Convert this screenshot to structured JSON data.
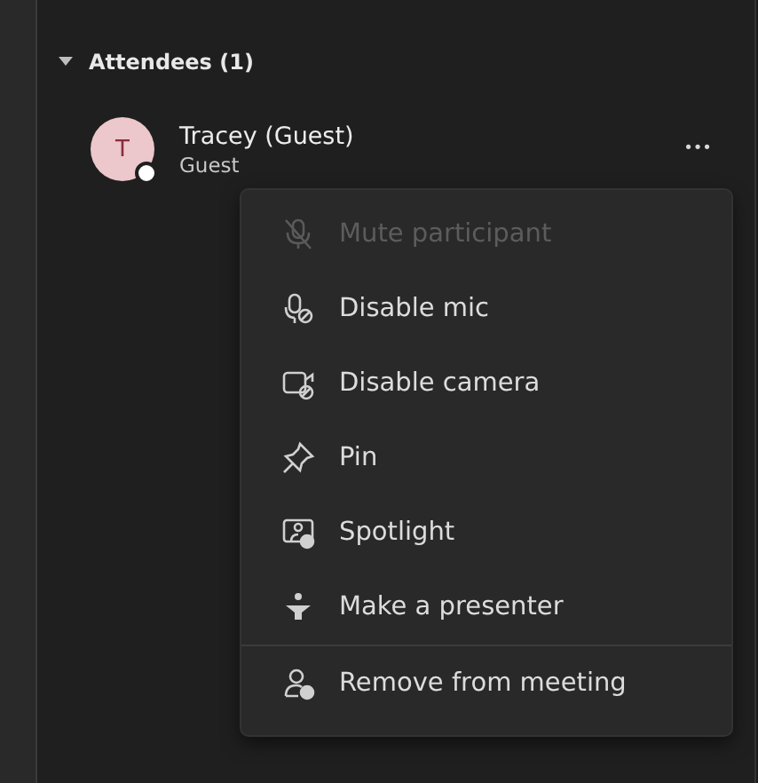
{
  "section": {
    "title": "Attendees (1)",
    "expanded": true
  },
  "attendee": {
    "initial": "T",
    "name": "Tracey (Guest)",
    "role": "Guest",
    "more": "•••"
  },
  "menu": {
    "groups": [
      [
        {
          "label": "Mute participant",
          "disabled": true
        },
        {
          "label": "Disable mic",
          "disabled": false
        },
        {
          "label": "Disable camera",
          "disabled": false
        },
        {
          "label": "Pin",
          "disabled": false
        },
        {
          "label": "Spotlight",
          "disabled": false
        },
        {
          "label": "Make a presenter",
          "disabled": false
        }
      ],
      [
        {
          "label": "Remove from meeting",
          "disabled": false
        }
      ]
    ]
  }
}
